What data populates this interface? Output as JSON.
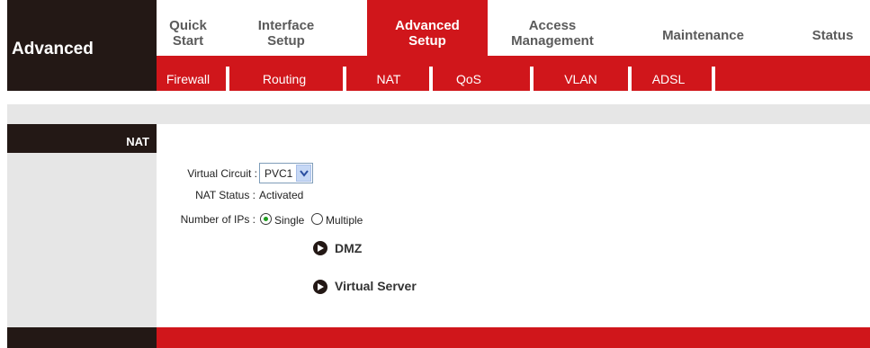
{
  "brand": {
    "title": "Advanced"
  },
  "main_nav": [
    {
      "line1": "Quick",
      "line2": "Start",
      "active": false
    },
    {
      "line1": "Interface",
      "line2": "Setup",
      "active": false
    },
    {
      "line1": "Advanced",
      "line2": "Setup",
      "active": true
    },
    {
      "line1": "Access",
      "line2": "Management",
      "active": false
    },
    {
      "line1": "Maintenance",
      "line2": "",
      "active": false
    },
    {
      "line1": "Status",
      "line2": "",
      "active": false
    }
  ],
  "sub_nav": [
    "Firewall",
    "Routing",
    "NAT",
    "QoS",
    "VLAN",
    "ADSL"
  ],
  "section": {
    "title": "NAT"
  },
  "form": {
    "virtual_circuit_label": "Virtual Circuit :",
    "virtual_circuit_value": "PVC1",
    "nat_status_label": "NAT Status :",
    "nat_status_value": "Activated",
    "num_ips_label": "Number of IPs :",
    "num_ips_options": [
      "Single",
      "Multiple"
    ],
    "num_ips_selected": "Single"
  },
  "links": [
    "DMZ",
    "Virtual Server"
  ],
  "colors": {
    "red": "#d0161b",
    "dark": "#231815",
    "grey": "#e6e6e6",
    "radio_selected": "#1f9d1f"
  }
}
